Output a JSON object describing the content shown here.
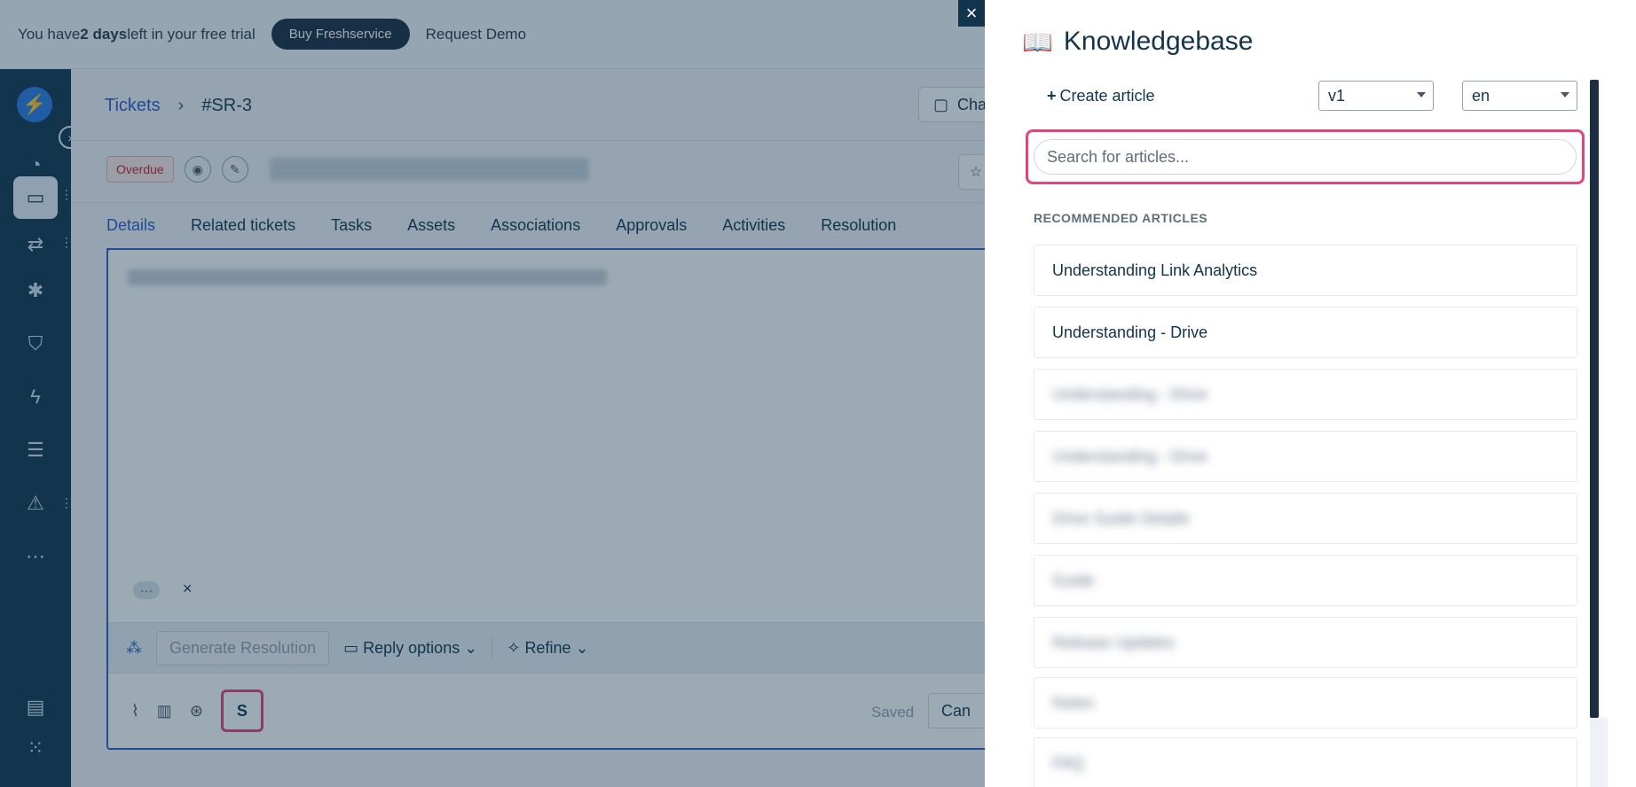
{
  "trial": {
    "prefix": "You have ",
    "bold": "2 days",
    "suffix": " left in your free trial",
    "buy_label": "Buy Freshservice",
    "demo_label": "Request Demo"
  },
  "ticket": {
    "breadcrumb_link": "Tickets",
    "breadcrumb_sep": "›",
    "breadcrumb_current": "#SR-3",
    "chat_label": "Cha",
    "status": "Overdue",
    "tabs": [
      "Details",
      "Related tickets",
      "Tasks",
      "Assets",
      "Associations",
      "Approvals",
      "Activities",
      "Resolution"
    ],
    "more_chip": "···",
    "chip_close": "×",
    "generate_label": "Generate Resolution",
    "reply_options_label": "Reply options",
    "refine_label": "Refine",
    "saved_label": "Saved",
    "cancel_label": "Can"
  },
  "kb": {
    "title": "Knowledgebase",
    "create_label": "Create article",
    "version_value": "v1",
    "lang_value": "en",
    "search_placeholder": "Search for articles...",
    "recommended_label": "RECOMMENDED ARTICLES",
    "articles": [
      "Understanding Link Analytics",
      "Understanding - Drive",
      "Understanding - Drive",
      "Understanding - Drive",
      "Drive Guide Details",
      "Guide",
      "Release Updates",
      "Notes",
      "FAQ"
    ]
  },
  "close_label": "×",
  "colors": {
    "accent": "#2c5cc5",
    "highlight": "#e0457b",
    "nav": "#12344d"
  }
}
